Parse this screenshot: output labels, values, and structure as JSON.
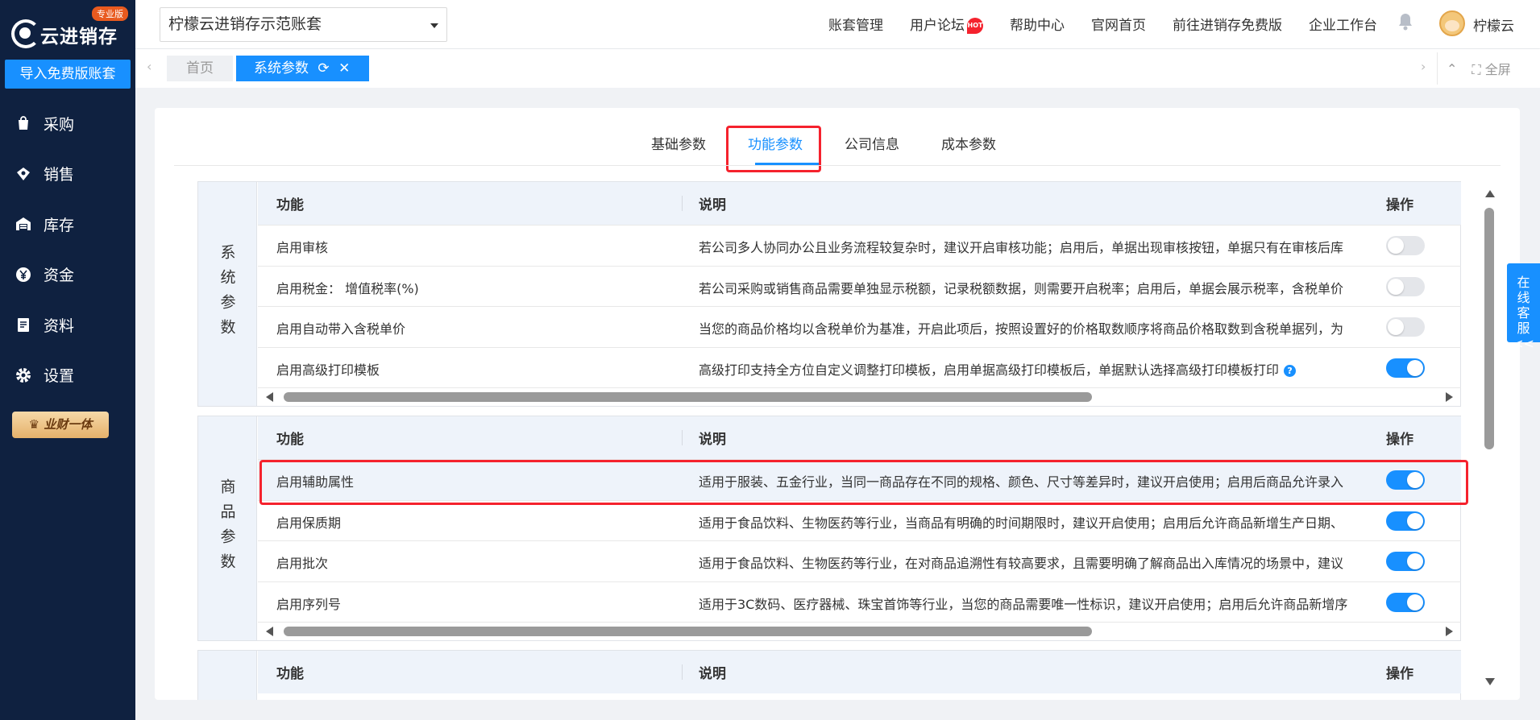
{
  "sidebar": {
    "logo_text": "云进销存",
    "version_badge": "专业版",
    "import_button": "导入免费版账套",
    "items": [
      {
        "label": "采购",
        "icon": "shopping-bag-icon"
      },
      {
        "label": "销售",
        "icon": "sales-tag-icon"
      },
      {
        "label": "库存",
        "icon": "warehouse-icon"
      },
      {
        "label": "资金",
        "icon": "yen-coin-icon"
      },
      {
        "label": "资料",
        "icon": "document-icon"
      },
      {
        "label": "设置",
        "icon": "gear-icon"
      }
    ],
    "promo_badge": "业财一体"
  },
  "header": {
    "account_select": "柠檬云进销存示范账套",
    "links": [
      {
        "label": "账套管理"
      },
      {
        "label": "用户论坛",
        "hot": "HOT"
      },
      {
        "label": "帮助中心"
      },
      {
        "label": "官网首页"
      },
      {
        "label": "前往进销存免费版"
      },
      {
        "label": "企业工作台"
      }
    ],
    "username": "柠檬云"
  },
  "tabbar": {
    "home": "首页",
    "active": "系统参数",
    "fullscreen": "全屏"
  },
  "param_tabs": [
    "基础参数",
    "功能参数",
    "公司信息",
    "成本参数"
  ],
  "active_param_tab": "功能参数",
  "table_headers": {
    "feature": "功能",
    "desc": "说明",
    "action": "操作"
  },
  "groups": [
    {
      "label": "系统参数",
      "rows": [
        {
          "feature": "启用审核",
          "desc": "若公司多人协同办公且业务流程较复杂时，建议开启审核功能；启用后，单据出现审核按钮，单据只有在审核后库",
          "enabled": false
        },
        {
          "feature": "启用税金： 增值税率(%)",
          "desc": "若公司采购或销售商品需要单独显示税额，记录税额数据，则需要开启税率；启用后，单据会展示税率，含税单价",
          "enabled": false
        },
        {
          "feature": "启用自动带入含税单价",
          "desc": "当您的商品价格均以含税单价为基准，开启此项后，按照设置好的价格取数顺序将商品价格取数到含税单据列，为",
          "enabled": false
        },
        {
          "feature": "启用高级打印模板",
          "desc": "高级打印支持全方位自定义调整打印模板，启用单据高级打印模板后，单据默认选择高级打印模板打印",
          "enabled": true,
          "help": "?"
        }
      ]
    },
    {
      "label": "商品参数",
      "rows": [
        {
          "feature": "启用辅助属性",
          "desc": "适用于服装、五金行业，当同一商品存在不同的规格、颜色、尺寸等差异时，建议开启使用；启用后商品允许录入",
          "enabled": true
        },
        {
          "feature": "启用保质期",
          "desc": "适用于食品饮料、生物医药等行业，当商品有明确的时间期限时，建议开启使用；启用后允许商品新增生产日期、",
          "enabled": true
        },
        {
          "feature": "启用批次",
          "desc": "适用于食品饮料、生物医药等行业，在对商品追溯性有较高要求，且需要明确了解商品出入库情况的场景中，建议",
          "enabled": true
        },
        {
          "feature": "启用序列号",
          "desc": "适用于3C数码、医疗器械、珠宝首饰等行业，当您的商品需要唯一性标识，建议开启使用；启用后允许商品新增序",
          "enabled": true
        }
      ]
    }
  ],
  "online_service": [
    "在",
    "线",
    "客",
    "服",
    "<<"
  ],
  "colors": {
    "accent": "#1890ff",
    "sidebar": "#0f2140",
    "highlight": "#f5222d"
  }
}
